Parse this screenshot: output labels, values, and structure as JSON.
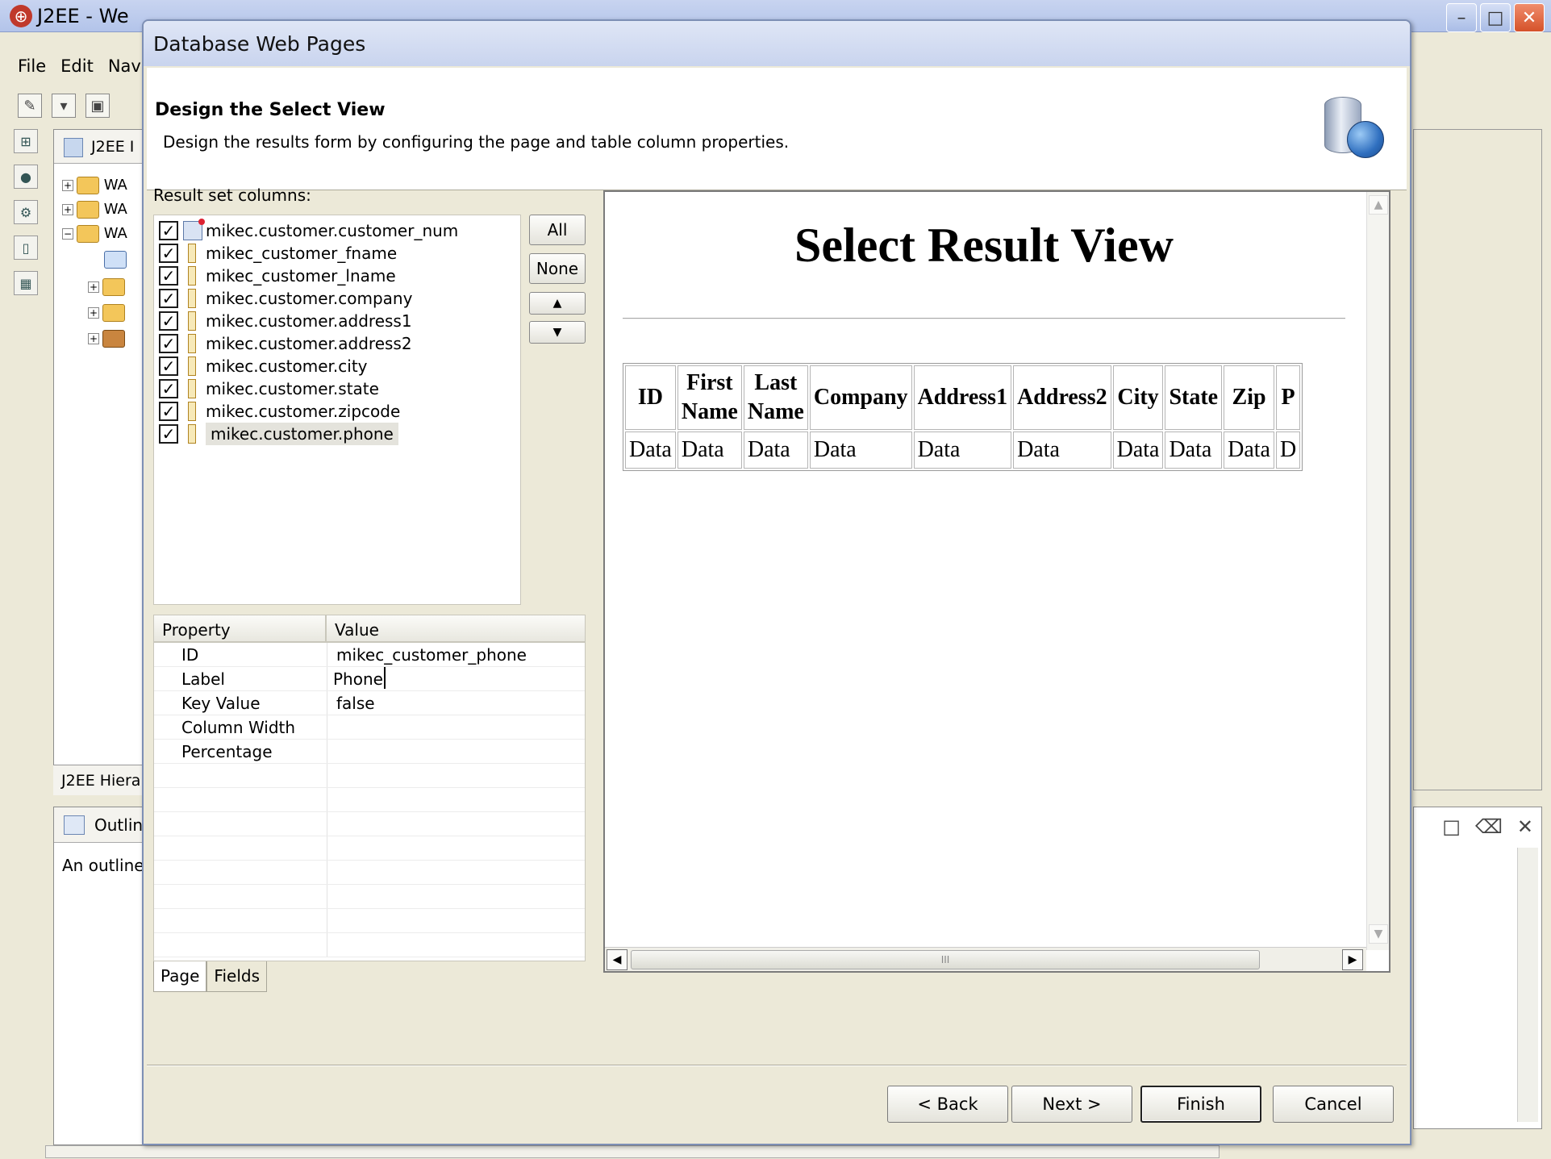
{
  "ide": {
    "title": "J2EE - We",
    "menu": [
      "File",
      "Edit",
      "Nav"
    ],
    "panel_tab": "J2EE I",
    "tree_items": [
      "WA",
      "WA",
      "WA"
    ],
    "hierarchy_tab": "J2EE Hiera",
    "outline_tab": "Outlin",
    "outline_text": "An outline"
  },
  "dialog": {
    "title": "Database Web Pages",
    "header_title": "Design the Select View",
    "header_desc": "Design the results form by configuring the page and table column properties.",
    "result_label": "Result set columns:",
    "columns": [
      {
        "label": "mikec.customer.customer_num",
        "checked": true,
        "key": true
      },
      {
        "label": "mikec_customer_fname",
        "checked": true,
        "key": false
      },
      {
        "label": "mikec_customer_lname",
        "checked": true,
        "key": false
      },
      {
        "label": "mikec.customer.company",
        "checked": true,
        "key": false
      },
      {
        "label": "mikec.customer.address1",
        "checked": true,
        "key": false
      },
      {
        "label": "mikec.customer.address2",
        "checked": true,
        "key": false
      },
      {
        "label": "mikec.customer.city",
        "checked": true,
        "key": false
      },
      {
        "label": "mikec.customer.state",
        "checked": true,
        "key": false
      },
      {
        "label": "mikec.customer.zipcode",
        "checked": true,
        "key": false
      },
      {
        "label": "mikec.customer.phone",
        "checked": true,
        "key": false
      }
    ],
    "buttons_side": {
      "all": "All",
      "none": "None",
      "up": "▲",
      "down": "▼"
    },
    "properties": {
      "header_property": "Property",
      "header_value": "Value",
      "rows": [
        {
          "name": "ID",
          "value": "mikec_customer_phone"
        },
        {
          "name": "Label",
          "value": "Phone"
        },
        {
          "name": "Key Value",
          "value": "false"
        },
        {
          "name": "Column Width",
          "value": ""
        },
        {
          "name": "Percentage",
          "value": ""
        }
      ]
    },
    "tabs": [
      "Page",
      "Fields"
    ],
    "preview": {
      "title": "Select Result View",
      "headers": [
        "ID",
        "First Name",
        "Last Name",
        "Company",
        "Address1",
        "Address2",
        "City",
        "State",
        "Zip",
        "P"
      ],
      "cells": [
        "Data",
        "Data",
        "Data",
        "Data",
        "Data",
        "Data",
        "Data",
        "Data",
        "Data",
        "D"
      ],
      "scroll_grip": "III"
    },
    "footer_buttons": {
      "back": "< Back",
      "next": "Next >",
      "finish": "Finish",
      "cancel": "Cancel"
    }
  }
}
